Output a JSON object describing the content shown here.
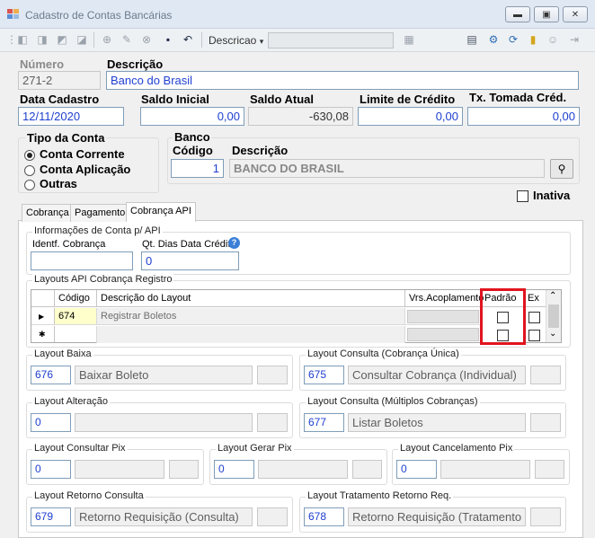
{
  "window": {
    "title": "Cadastro de Contas Bancárias"
  },
  "toolbar": {
    "search_field_label": "Descricao",
    "search_value": ""
  },
  "header": {
    "numero_label": "Número",
    "numero_value": "271-2",
    "descricao_label": "Descrição",
    "descricao_value": "Banco do Brasil",
    "data_cadastro_label": "Data Cadastro",
    "data_cadastro_value": "12/11/2020",
    "saldo_inicial_label": "Saldo Inicial",
    "saldo_inicial_value": "0,00",
    "saldo_atual_label": "Saldo Atual",
    "saldo_atual_value": "-630,08",
    "limite_credito_label": "Limite de Crédito",
    "limite_credito_value": "0,00",
    "tx_tomada_label": "Tx. Tomada Créd.",
    "tx_tomada_value": "0,00"
  },
  "tipo_conta": {
    "title": "Tipo da Conta",
    "options": [
      "Conta Corrente",
      "Conta Aplicação",
      "Outras"
    ],
    "selected": "Conta Corrente"
  },
  "banco": {
    "title": "Banco",
    "codigo_label": "Código",
    "codigo_value": "1",
    "descricao_label": "Descrição",
    "descricao_value": "BANCO DO BRASIL"
  },
  "inativa": {
    "label": "Inativa",
    "checked": false
  },
  "tabs": [
    {
      "label": "Cobrança"
    },
    {
      "label": "Pagamento"
    },
    {
      "label": "Cobrança API"
    }
  ],
  "active_tab": "Cobrança API",
  "info_api": {
    "title": "Informações de Conta p/ API",
    "identf_label": "Identf. Cobrança",
    "identf_value": "",
    "qt_dias_label": "Qt. Dias Data Crédito",
    "qt_dias_value": "0"
  },
  "layouts_grid": {
    "title": "Layouts API Cobrança Registro",
    "columns": [
      "Código",
      "Descrição do Layout",
      "Vrs.Acoplamento",
      "Padrão",
      "Ex"
    ],
    "rows": [
      {
        "codigo": "674",
        "descricao": "Registrar Boletos",
        "vrs": "",
        "padrao": false,
        "ex": false
      }
    ]
  },
  "layouts": {
    "baixa": {
      "title": "Layout Baixa",
      "code": "676",
      "desc": "Baixar Boleto"
    },
    "consulta_unica": {
      "title": "Layout Consulta (Cobrança Única)",
      "code": "675",
      "desc": "Consultar Cobrança (Individual)"
    },
    "alteracao": {
      "title": "Layout Alteração",
      "code": "0",
      "desc": ""
    },
    "consulta_multiplos": {
      "title": "Layout Consulta (Múltiplos Cobranças)",
      "code": "677",
      "desc": "Listar Boletos"
    },
    "consultar_pix": {
      "title": "Layout Consultar Pix",
      "code": "0",
      "desc": ""
    },
    "gerar_pix": {
      "title": "Layout Gerar Pix",
      "code": "0",
      "desc": ""
    },
    "cancelamento_pix": {
      "title": "Layout Cancelamento Pix",
      "code": "0",
      "desc": ""
    },
    "retorno_consulta": {
      "title": "Layout Retorno Consulta",
      "code": "679",
      "desc": "Retorno Requisição (Consulta)"
    },
    "tratamento_retorno": {
      "title": "Layout Tratamento Retorno Req.",
      "code": "678",
      "desc": "Retorno Requisição (Tratamento E"
    }
  },
  "colors": {
    "highlight": "#e0141e",
    "input_text": "#1f3fd0",
    "titlebar": "#dfe8f3"
  }
}
